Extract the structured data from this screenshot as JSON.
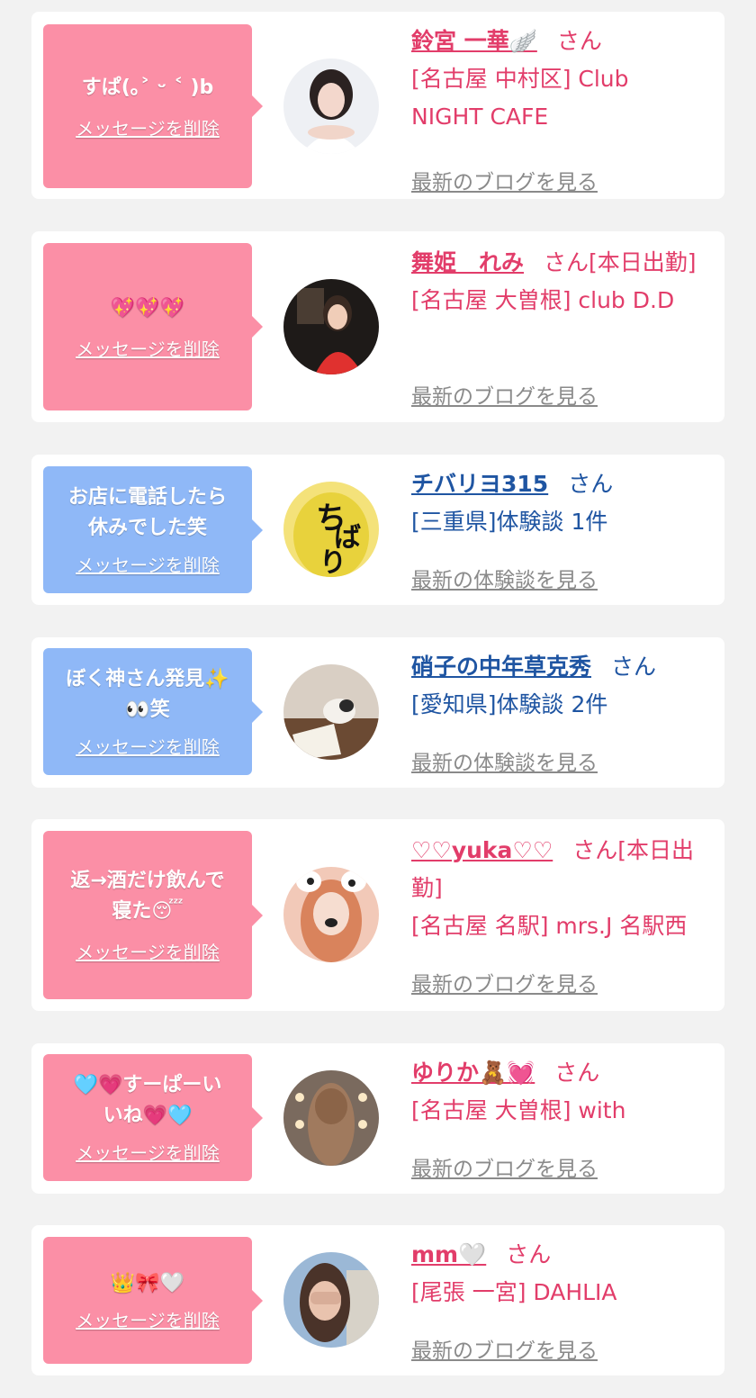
{
  "delete_label": "メッセージを削除",
  "san_label": "さん",
  "colors": {
    "pink_bubble": "#fb8fa6",
    "blue_bubble": "#8fb8f7",
    "pink_text": "#e23d6a",
    "blue_text": "#1f55a2"
  },
  "items": [
    {
      "message": "すぱ(｡˃ ᵕ ˂ )b",
      "name": "鈴宮 一華🪽",
      "suffix": "",
      "detail": "[名古屋 中村区] Club\nNIGHT CAFE",
      "link": "最新のブログを見る",
      "type": "girl"
    },
    {
      "message": "💖💖💖",
      "name": "舞姫　れみ",
      "suffix": "[本日出勤]",
      "detail": "[名古屋 大曽根] club D.D",
      "link": "最新のブログを見る",
      "type": "girl"
    },
    {
      "message": "お店に電話したら\n休みでした笑",
      "name": "チバリヨ315",
      "suffix": "",
      "detail": "[三重県]体験談 1件",
      "link": "最新の体験談を見る",
      "type": "user"
    },
    {
      "message": "ぼく神さん発見✨\n👀笑",
      "name": "硝子の中年草克秀",
      "suffix": "",
      "detail": "[愛知県]体験談 2件",
      "link": "最新の体験談を見る",
      "type": "user"
    },
    {
      "message": "返→酒だけ飲んで\n寝た😴",
      "name": "♡♡yuka♡♡",
      "suffix": "[本日出勤]",
      "detail": "[名古屋 名駅] mrs.J 名駅西",
      "link": "最新のブログを見る",
      "type": "girl"
    },
    {
      "message": "🩵💗すーぱーい\nいね💗🩵",
      "name": "ゆりか🧸💓",
      "suffix": "",
      "detail": "[名古屋 大曽根] with",
      "link": "最新のブログを見る",
      "type": "girl"
    },
    {
      "message": "👑🎀🤍",
      "name": "mm🤍",
      "suffix": "",
      "detail": "[尾張 一宮] DAHLIA",
      "link": "最新のブログを見る",
      "type": "girl"
    }
  ]
}
